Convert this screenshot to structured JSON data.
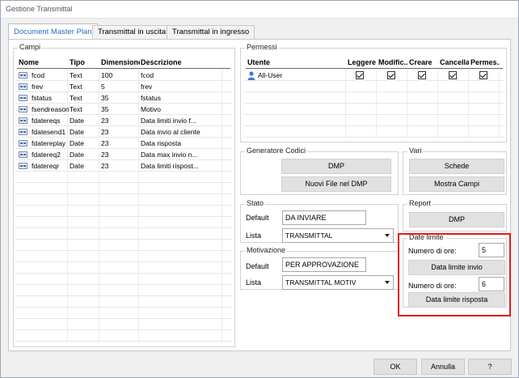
{
  "window": {
    "title": "Gestione Transmittal"
  },
  "tabs": [
    {
      "label": "Document Master Plan",
      "active": true
    },
    {
      "label": "Transmittal in uscita",
      "active": false
    },
    {
      "label": "Transmittal in ingresso",
      "active": false
    }
  ],
  "campi": {
    "legend": "Campi",
    "headers": {
      "nome": "Nome",
      "tipo": "Tipo",
      "dimensione": "Dimensione",
      "descrizione": "Descrizione"
    },
    "rows": [
      {
        "nome": "fcod",
        "tipo": "Text",
        "dimensione": "100",
        "descrizione": "fcod"
      },
      {
        "nome": "frev",
        "tipo": "Text",
        "dimensione": "5",
        "descrizione": "frev"
      },
      {
        "nome": "fstatus",
        "tipo": "Text",
        "dimensione": "35",
        "descrizione": "fstatus"
      },
      {
        "nome": "fsendreason",
        "tipo": "Text",
        "dimensione": "35",
        "descrizione": "Motivo"
      },
      {
        "nome": "fdatereqs",
        "tipo": "Date",
        "dimensione": "23",
        "descrizione": "Data limiti invio f..."
      },
      {
        "nome": "fdatesend1",
        "tipo": "Date",
        "dimensione": "23",
        "descrizione": "Data invio al cliente"
      },
      {
        "nome": "fdatereplay",
        "tipo": "Date",
        "dimensione": "23",
        "descrizione": "Data risposta"
      },
      {
        "nome": "fdatereq2",
        "tipo": "Date",
        "dimensione": "23",
        "descrizione": "Data max invio n..."
      },
      {
        "nome": "fdatereqr",
        "tipo": "Date",
        "dimensione": "23",
        "descrizione": "Data limiti rispost..."
      }
    ]
  },
  "permessi": {
    "legend": "Permessi",
    "headers": {
      "utente": "Utente",
      "leggere": "Leggere",
      "modificare": "Modific...",
      "creare": "Creare",
      "cancellare": "Cancella...",
      "permessi": "Permes..."
    },
    "rows": [
      {
        "utente": "All-User",
        "icon": "user-icon",
        "leggere": true,
        "modificare": true,
        "creare": true,
        "cancellare": true,
        "permessi": true
      }
    ]
  },
  "generatore": {
    "legend": "Generatore Codici",
    "dmp_button": "DMP",
    "nuovi_file_button": "Nuovi File nel DMP"
  },
  "vari": {
    "legend": "Vari",
    "schede_button": "Schede",
    "mostra_campi_button": "Mostra Campi"
  },
  "stato": {
    "legend": "Stato",
    "default_label": "Default",
    "default_value": "DA INVIARE",
    "lista_label": "Lista",
    "lista_value": "TRANSMITTAL"
  },
  "motivazione": {
    "legend": "Motivazione",
    "default_label": "Default",
    "default_value": "PER APPROVAZIONE",
    "lista_label": "Lista",
    "lista_value": "TRANSMITTAL MOTIV"
  },
  "report": {
    "legend": "Report",
    "dmp_button": "DMP"
  },
  "date_limite": {
    "legend": "Date limite",
    "ore_label_1": "Numero di ore:",
    "ore_value_1": "5",
    "invio_button": "Data limite invio",
    "ore_label_2": "Numero di ore:",
    "ore_value_2": "6",
    "risposta_button": "Data limite risposta",
    "highlight_color": "#e11b1b"
  },
  "footer": {
    "ok_button": "OK",
    "annulla_button": "Annulla",
    "help_button": "?"
  }
}
